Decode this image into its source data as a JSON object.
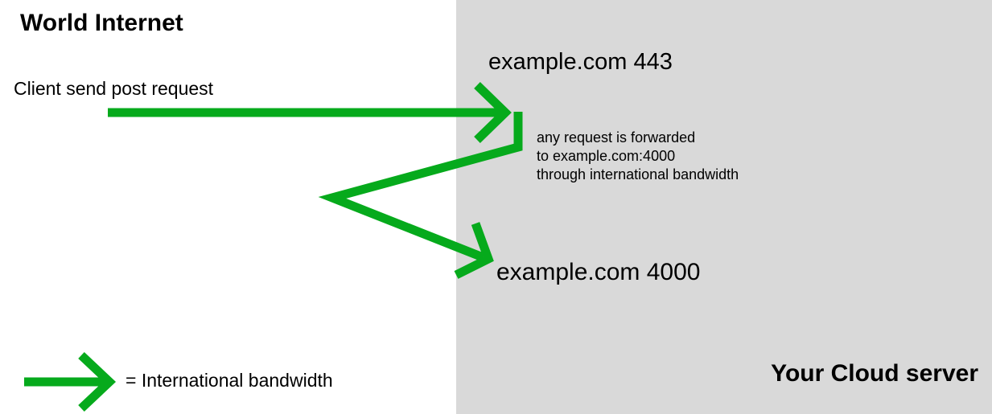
{
  "regions": {
    "left_title": "World Internet",
    "right_title": "Your Cloud server"
  },
  "nodes": {
    "client": "Client send post request",
    "server_443": "example.com 443",
    "server_4000": "example.com 4000"
  },
  "note": {
    "line1": "any request is forwarded",
    "line2": "to example.com:4000",
    "line3": "through international bandwidth"
  },
  "legend": {
    "text": "= International bandwidth",
    "icon": "green-arrow-icon"
  },
  "colors": {
    "arrow": "#06aa1c",
    "server_panel": "#d9d9d9",
    "internet_panel": "#ffffff"
  }
}
